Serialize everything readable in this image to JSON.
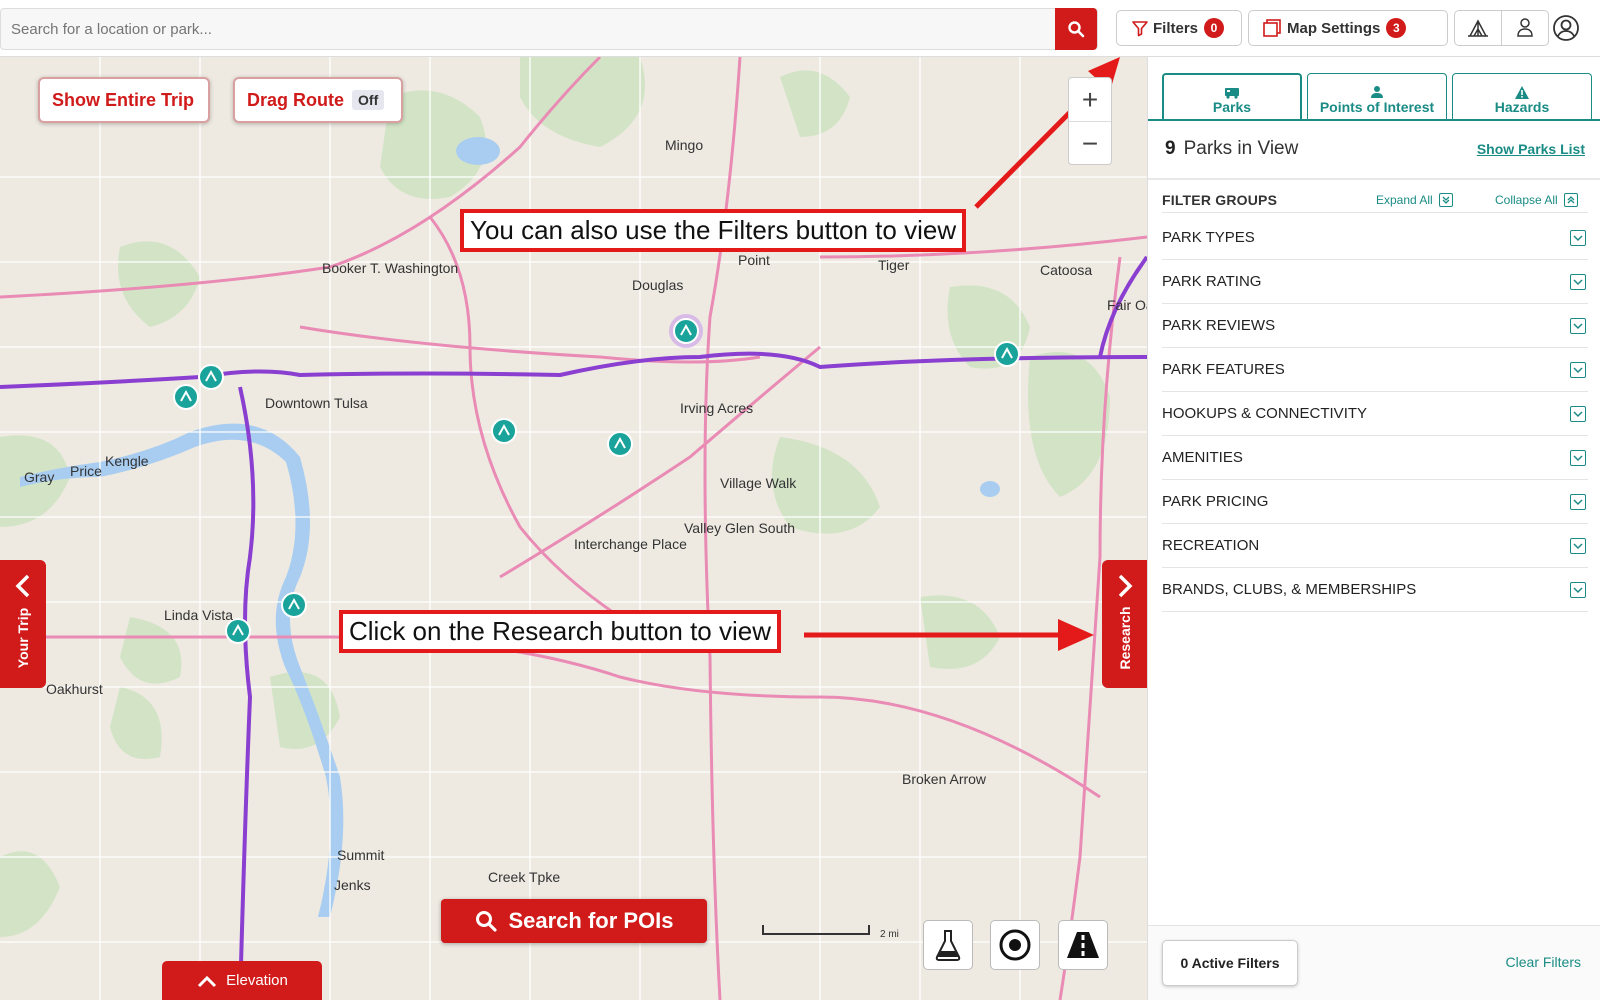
{
  "search": {
    "placeholder": "Search for a location or park..."
  },
  "topbar": {
    "filters_label": "Filters",
    "filters_count": "0",
    "map_settings_label": "Map Settings",
    "map_settings_count": "3"
  },
  "map": {
    "show_entire_trip": "Show Entire Trip",
    "drag_route": "Drag Route",
    "drag_route_state": "Off",
    "zoom_in": "+",
    "zoom_out": "−",
    "your_trip": "Your Trip",
    "research": "Research",
    "search_pois": "Search for POIs",
    "elevation": "Elevation",
    "scale": "2 mi",
    "labels": [
      "Downtown Tulsa",
      "Booker T. Washington",
      "Irving Acres",
      "Village Walk",
      "Valley Glen South",
      "Interchange Place",
      "Broken Arrow",
      "Catoosa",
      "Linda Vista",
      "Oakhurst",
      "Summit",
      "Jenks",
      "Mingo",
      "Tiger",
      "Point",
      "Douglas",
      "Kengle",
      "Price",
      "Gray",
      "Fair Oaks",
      "Creek Tpke"
    ]
  },
  "annotations": {
    "filters_note": "You can also use the Filters button to view",
    "research_note": "Click on the Research button to view"
  },
  "panel": {
    "tabs": [
      {
        "label": "Parks",
        "icon": "rv-icon"
      },
      {
        "label": "Points of Interest",
        "icon": "person-pin-icon"
      },
      {
        "label": "Hazards",
        "icon": "warning-icon"
      }
    ],
    "parks_count": "9",
    "parks_in_view": "Parks in View",
    "show_parks_list": "Show Parks List",
    "filter_groups_title": "FILTER GROUPS",
    "expand_all": "Expand All",
    "collapse_all": "Collapse All",
    "filter_groups": [
      "PARK TYPES",
      "PARK RATING",
      "PARK REVIEWS",
      "PARK FEATURES",
      "HOOKUPS & CONNECTIVITY",
      "AMENITIES",
      "PARK PRICING",
      "RECREATION",
      "BRANDS, CLUBS, & MEMBERSHIPS"
    ],
    "active_filters": "0 Active Filters",
    "clear_filters": "Clear Filters"
  },
  "colors": {
    "accent_red": "#d11a1a",
    "teal": "#1a8c85",
    "annotation_red": "#e41a1a"
  }
}
